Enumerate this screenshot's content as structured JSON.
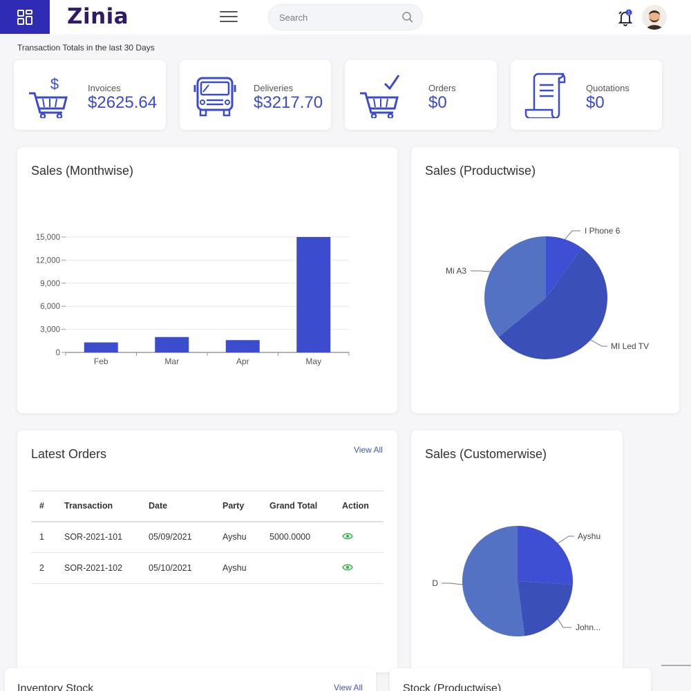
{
  "app": {
    "logo_text": "Zinia"
  },
  "header": {
    "search_placeholder": "Search",
    "menu_icon": "grid-icon",
    "notification_count": "1"
  },
  "caption": "Transaction Totals in the last 30 Days",
  "stats": [
    {
      "label": "Invoices",
      "value": "$2625.64",
      "icon": "cart-dollar-icon"
    },
    {
      "label": "Deliveries",
      "value": "$3217.70",
      "icon": "bus-icon"
    },
    {
      "label": "Orders",
      "value": "$0",
      "icon": "cart-check-icon"
    },
    {
      "label": "Quotations",
      "value": "$0",
      "icon": "scroll-document-icon"
    }
  ],
  "panels": {
    "monthwise_title": "Sales (Monthwise)",
    "productwise_title": "Sales (Productwise)",
    "latest_orders_title": "Latest Orders",
    "customerwise_title": "Sales (Customerwise)",
    "inventory_title": "Inventory Stock",
    "stock_productwise_title": "Stock (Productwise)",
    "view_all": "View All"
  },
  "orders": {
    "headers": [
      "#",
      "Transaction",
      "Date",
      "Party",
      "Grand Total",
      "Action"
    ],
    "rows": [
      [
        "1",
        "SOR-2021-101",
        "05/09/2021",
        "Ayshu",
        "5000.0000"
      ],
      [
        "2",
        "SOR-2021-102",
        "05/10/2021",
        "Ayshu",
        ""
      ]
    ]
  },
  "colors": {
    "accent": "#3a4ad0",
    "brand": "#2f2bb5",
    "bar": "#3b4ccf",
    "eye": "#3bb54a"
  },
  "chart_data": [
    {
      "type": "bar",
      "title": "Sales (Monthwise)",
      "categories": [
        "Feb",
        "Mar",
        "Apr",
        "May"
      ],
      "values": [
        1300,
        2000,
        1600,
        15000
      ],
      "ylim": [
        0,
        15000
      ],
      "yticks": [
        0,
        3000,
        6000,
        9000,
        12000,
        15000
      ],
      "ytick_labels": [
        "0",
        "3,000",
        "6,000",
        "9,000",
        "12,000",
        "15,000"
      ],
      "grid": true
    },
    {
      "type": "pie",
      "title": "Sales (Productwise)",
      "labels": [
        "I Phone 6",
        "MI Led TV",
        "Mi A3"
      ],
      "values": [
        10,
        54,
        36
      ],
      "colors": [
        "#3f4fd4",
        "#3a4fb8",
        "#5472c4"
      ]
    },
    {
      "type": "pie",
      "title": "Sales (Customerwise)",
      "labels": [
        "Ayshu",
        "John...",
        "D"
      ],
      "values": [
        26,
        22,
        52
      ],
      "colors": [
        "#3f4fd4",
        "#3a4fb8",
        "#5472c4"
      ]
    }
  ]
}
